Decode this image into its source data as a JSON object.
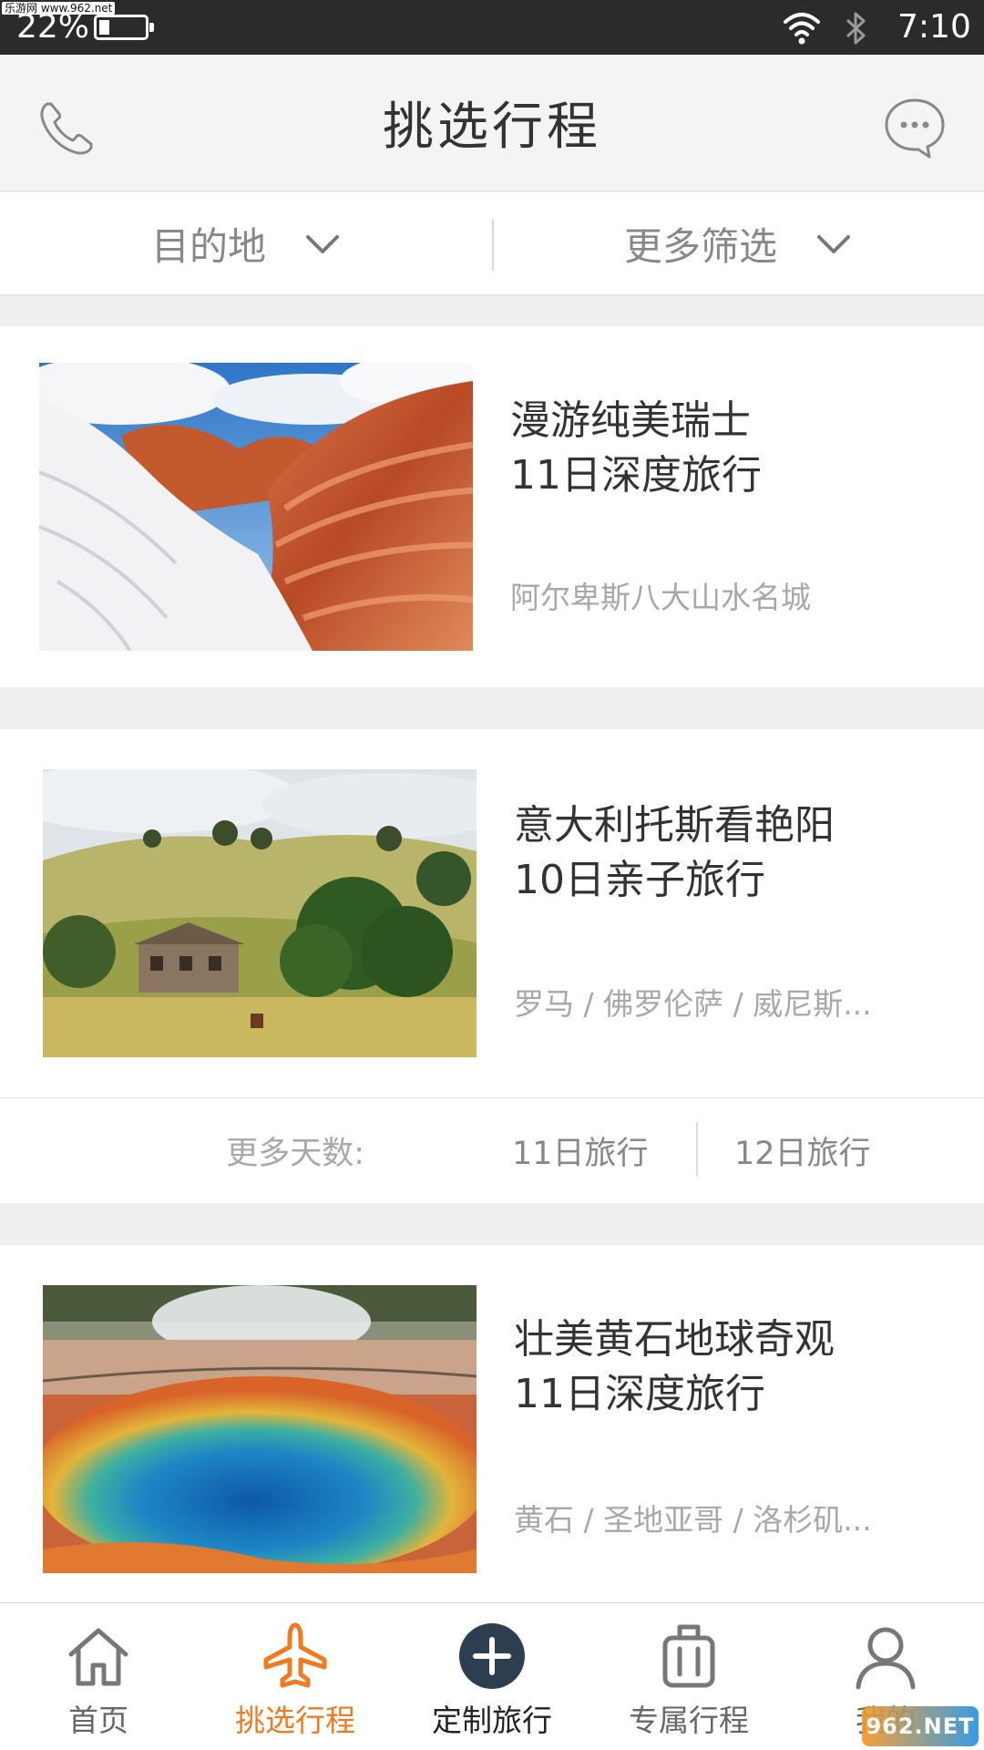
{
  "status_bar": {
    "watermark": "乐游网 www.962.net",
    "battery_percent": "22%",
    "battery_level": 0.22,
    "time": "7:10",
    "icons": [
      "wifi-icon",
      "bluetooth-icon"
    ]
  },
  "header": {
    "title": "挑选行程",
    "left_icon": "phone-icon",
    "right_icon": "chat-bubble-icon"
  },
  "filters": [
    {
      "label": "目的地",
      "icon": "chevron-down-icon"
    },
    {
      "label": "更多筛选",
      "icon": "chevron-down-icon"
    }
  ],
  "trips": [
    {
      "title_line1": "漫游纯美瑞士",
      "title_line2": "11日深度旅行",
      "subtitle": "阿尔卑斯八大山水名城",
      "image": "red sandstone canyon with snow"
    },
    {
      "title_line1": "意大利托斯看艳阳",
      "title_line2": "10日亲子旅行",
      "subtitle": "罗马 / 佛罗伦萨 / 威尼斯...",
      "image": "old farmhouse on green hillside",
      "more_days_label": "更多天数:",
      "more_days_options": [
        "11日旅行",
        "12日旅行"
      ]
    },
    {
      "title_line1": "壮美黄石地球奇观",
      "title_line2": "11日深度旅行",
      "subtitle": "黄石 / 圣地亚哥 / 洛杉矶...",
      "image": "colorful hot spring pool"
    }
  ],
  "bottom_nav": [
    {
      "label": "首页",
      "icon": "home-icon",
      "active": false
    },
    {
      "label": "挑选行程",
      "icon": "airplane-icon",
      "active": true
    },
    {
      "label": "定制旅行",
      "icon": "plus-circle-icon",
      "active": false
    },
    {
      "label": "专属行程",
      "icon": "suitcase-icon",
      "active": false
    },
    {
      "label": "我的",
      "icon": "user-icon",
      "active": false
    }
  ],
  "bottom_watermark": "962.NET",
  "colors": {
    "accent": "#f07a20",
    "status_bar_bg": "#2b2b2b",
    "header_bg": "#f4f4f4",
    "page_bg": "#eeeeee",
    "center_button": "#2d3e50"
  }
}
